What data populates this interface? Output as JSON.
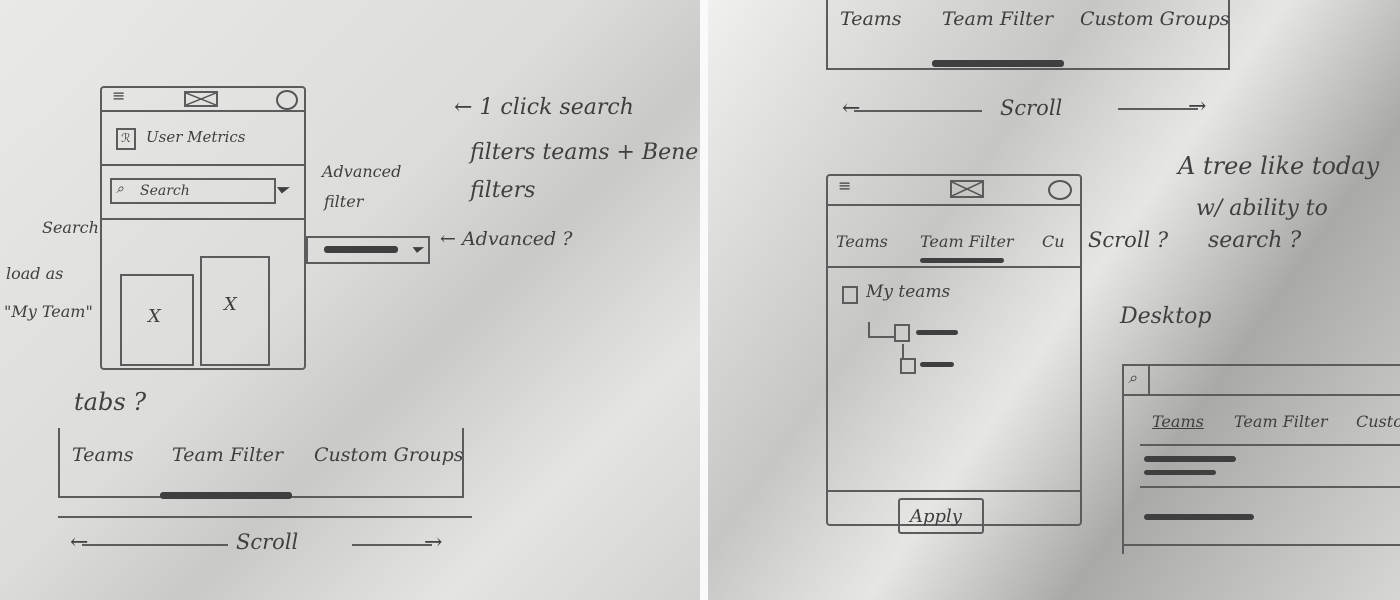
{
  "left_sheet": {
    "phone": {
      "user_label": "User Metrics",
      "search_label": "Search",
      "tile_marks": [
        "X",
        "X"
      ]
    },
    "notes": {
      "search_note_1": "← 1 click search",
      "search_note_2": "filters teams + Bene",
      "search_note_3": "filters",
      "advanced_filter_1": "Advanced",
      "advanced_filter_2": "filter",
      "search_arrow": "Search",
      "load_as_1": "load as",
      "load_as_2": "\"My Team\"",
      "advanced_q": "← Advanced ?",
      "tabs_q": "tabs ?",
      "scroll": "Scroll"
    },
    "tabs": [
      "Teams",
      "Team Filter",
      "Custom Groups"
    ]
  },
  "right_sheet": {
    "top_tabs": [
      "Teams",
      "Team Filter",
      "Custom Groups"
    ],
    "scroll": "Scroll",
    "phone": {
      "tabs": [
        "Teams",
        "Team Filter",
        "Cu"
      ],
      "my_teams": "My teams",
      "apply": "Apply"
    },
    "notes": {
      "scroll_q": "Scroll ?",
      "tree_1": "A tree like today",
      "tree_2": "w/ ability to",
      "tree_3": "search ?",
      "desktop": "Desktop"
    },
    "desktop_tabs": [
      "Teams",
      "Team Filter",
      "Custo"
    ]
  }
}
